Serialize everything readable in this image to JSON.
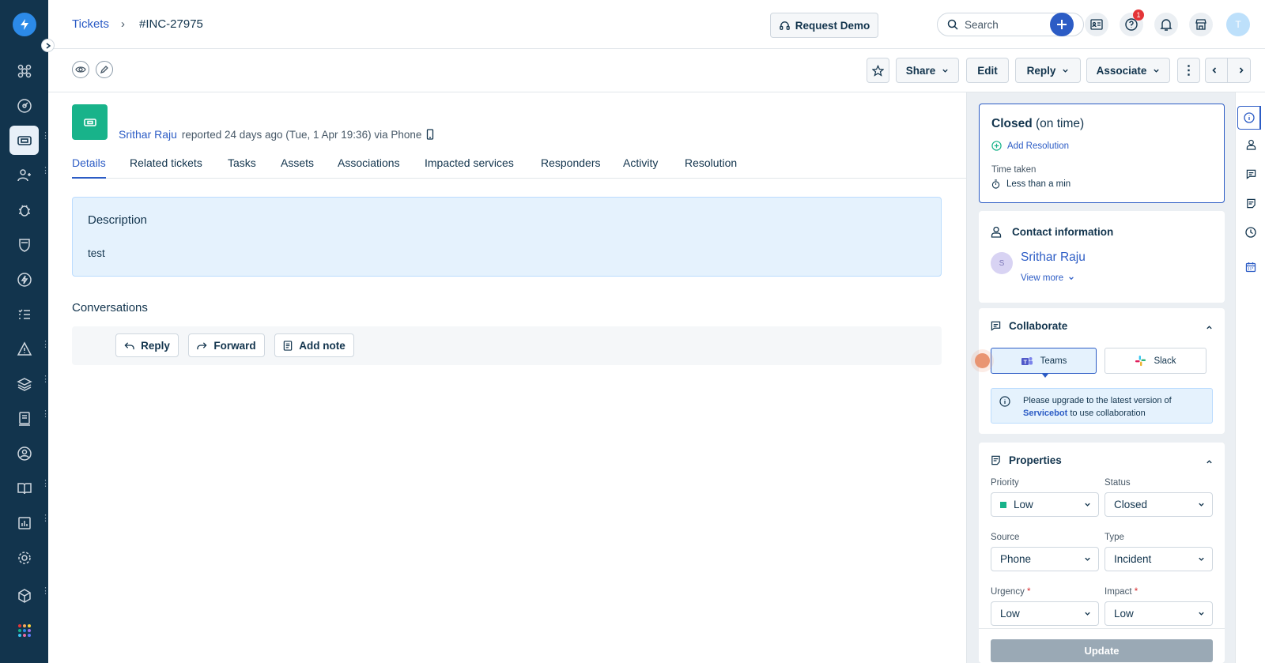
{
  "app": {
    "brand_color": "#2c8ae8",
    "nav_bg": "#12344d"
  },
  "breadcrumb": {
    "parent": "Tickets",
    "separator": "›",
    "current": "#INC-27975"
  },
  "header": {
    "request_demo": "Request Demo",
    "search_placeholder": "Search",
    "notification_count": "1",
    "avatar_initial": "T"
  },
  "toolbar": {
    "share": "Share",
    "edit": "Edit",
    "reply": "Reply",
    "associate": "Associate"
  },
  "ticket": {
    "reporter_name": "Srithar Raju",
    "reporter_meta": "reported 24 days ago (Tue, 1 Apr 19:36) via Phone"
  },
  "tabs": [
    "Details",
    "Related tickets",
    "Tasks",
    "Assets",
    "Associations",
    "Impacted services",
    "Responders",
    "Activity",
    "Resolution"
  ],
  "description": {
    "title": "Description",
    "body": "test"
  },
  "conversations": {
    "title": "Conversations",
    "reply": "Reply",
    "forward": "Forward",
    "add_note": "Add note"
  },
  "status_card": {
    "status": "Closed",
    "status_suffix": "(on time)",
    "add_resolution": "Add Resolution",
    "time_taken_label": "Time taken",
    "time_taken_value": "Less than a min"
  },
  "contact": {
    "title": "Contact information",
    "avatar_initial": "S",
    "name": "Srithar Raju",
    "view_more": "View more"
  },
  "collaborate": {
    "title": "Collaborate",
    "teams": "Teams",
    "slack": "Slack",
    "notice_prefix": "Please upgrade to the latest version of",
    "notice_link": "Servicebot",
    "notice_suffix": "to use collaboration"
  },
  "properties": {
    "title": "Properties",
    "priority_label": "Priority",
    "priority_value": "Low",
    "priority_color": "#18b38a",
    "status_label": "Status",
    "status_value": "Closed",
    "source_label": "Source",
    "source_value": "Phone",
    "type_label": "Type",
    "type_value": "Incident",
    "urgency_label": "Urgency",
    "urgency_value": "Low",
    "impact_label": "Impact",
    "impact_value": "Low",
    "required_mark": "*",
    "update": "Update"
  }
}
